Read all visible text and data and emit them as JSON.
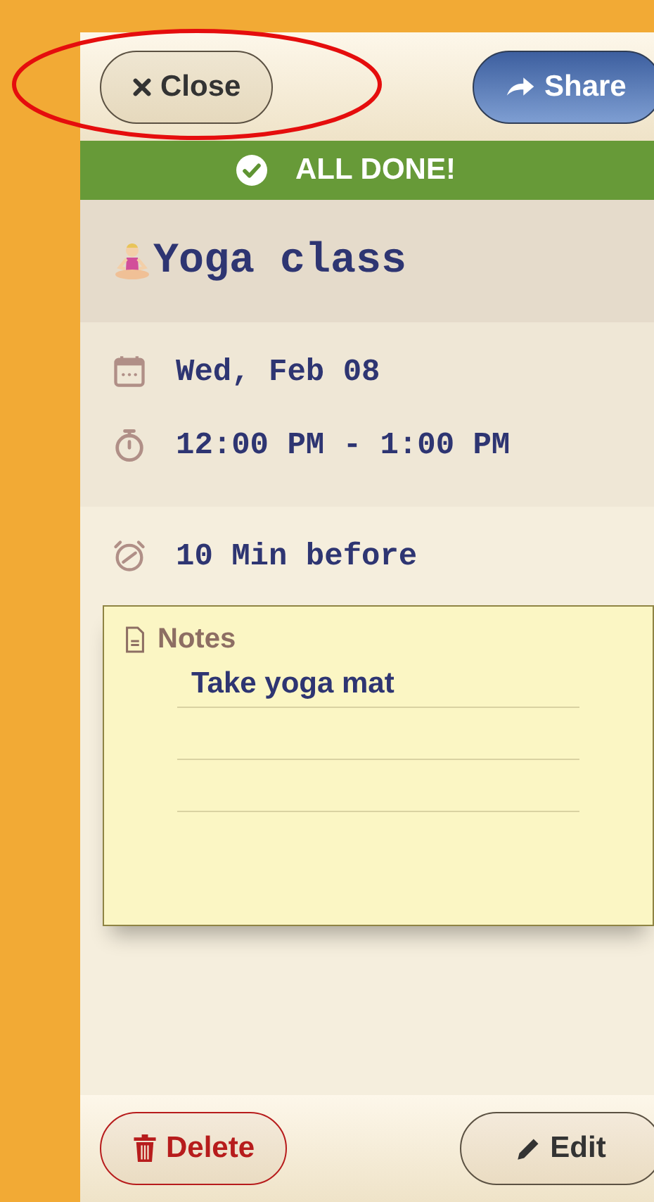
{
  "header": {
    "close_label": "Close",
    "share_label": "Share"
  },
  "banner": {
    "text": "ALL DONE!"
  },
  "title": "Yoga class",
  "details": [
    {
      "kind": "date",
      "text": "Wed, Feb 08"
    },
    {
      "kind": "time",
      "text": "12:00 PM - 1:00 PM"
    }
  ],
  "reminder": {
    "text": "10 Min before"
  },
  "notes": {
    "title": "Notes",
    "lines": [
      "Take yoga mat"
    ]
  },
  "footer": {
    "delete_label": "Delete",
    "edit_label": "Edit"
  }
}
